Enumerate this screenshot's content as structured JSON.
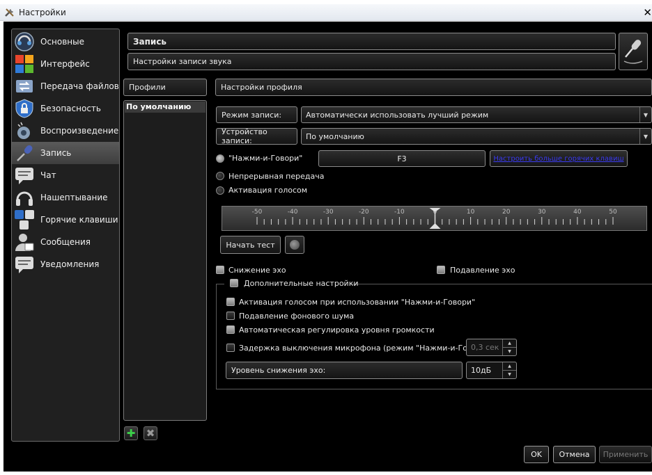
{
  "window": {
    "title": "Настройки",
    "close_glyph": "✕"
  },
  "nav": {
    "items": [
      {
        "label": "Основные",
        "icon": "teamspeak-logo-icon"
      },
      {
        "label": "Интерфейс",
        "icon": "windows-tiles-icon"
      },
      {
        "label": "Передача файлов",
        "icon": "file-transfer-icon"
      },
      {
        "label": "Безопасность",
        "icon": "shield-lock-icon"
      },
      {
        "label": "Воспроизведение",
        "icon": "speaker-icon"
      },
      {
        "label": "Запись",
        "icon": "microphone-icon",
        "active": true
      },
      {
        "label": "Чат",
        "icon": "chat-icon"
      },
      {
        "label": "Нашептывание",
        "icon": "headset-icon"
      },
      {
        "label": "Горячие клавиши",
        "icon": "keyboard-keys-icon"
      },
      {
        "label": "Сообщения",
        "icon": "message-user-icon"
      },
      {
        "label": "Уведомления",
        "icon": "notification-icon"
      }
    ]
  },
  "header": {
    "title": "Запись",
    "subtitle": "Настройки записи звука",
    "icon": "microphone-icon"
  },
  "profiles": {
    "header": "Профили",
    "items": [
      "По умолчанию"
    ],
    "add_glyph": "✚",
    "remove_glyph": "✖"
  },
  "profile_settings": {
    "header": "Настройки профиля",
    "mode_label": "Режим записи:",
    "mode_value": "Автоматически использовать лучший режим",
    "device_label": "Устройство записи:",
    "device_value": "По умолчанию",
    "activation": {
      "ptt_label": "\"Нажми-и-Говори\"",
      "ptt_key": "F3",
      "more_hotkeys": "Настроить больше горячих клавиш",
      "continuous_label": "Непрерывная передача",
      "voice_label": "Активация голосом",
      "selected": "ptt"
    },
    "slider": {
      "ticks": [
        "-50",
        "-40",
        "-30",
        "-20",
        "-10",
        "0",
        "10",
        "20",
        "30",
        "40",
        "50"
      ],
      "value": 0
    },
    "start_test": "Начать тест",
    "echo_reduction": "Снижение эхо",
    "echo_cancellation": "Подавление эхо",
    "advanced": {
      "title": "Дополнительные настройки",
      "opt1": "Активация голосом при использовании \"Нажми-и-Говори\"",
      "opt2": "Подавление фонового шума",
      "opt3": "Автоматическая регулировка уровня громкости",
      "opt4": "Задержка выключения микрофона (режим \"Нажми-и-Говори\"):",
      "delay_value": "0,3 сек",
      "echo_level_label": "Уровень снижения эхо:",
      "echo_level_value": "10дБ"
    }
  },
  "footer": {
    "ok": "OK",
    "cancel": "Отмена",
    "apply": "Применить"
  }
}
